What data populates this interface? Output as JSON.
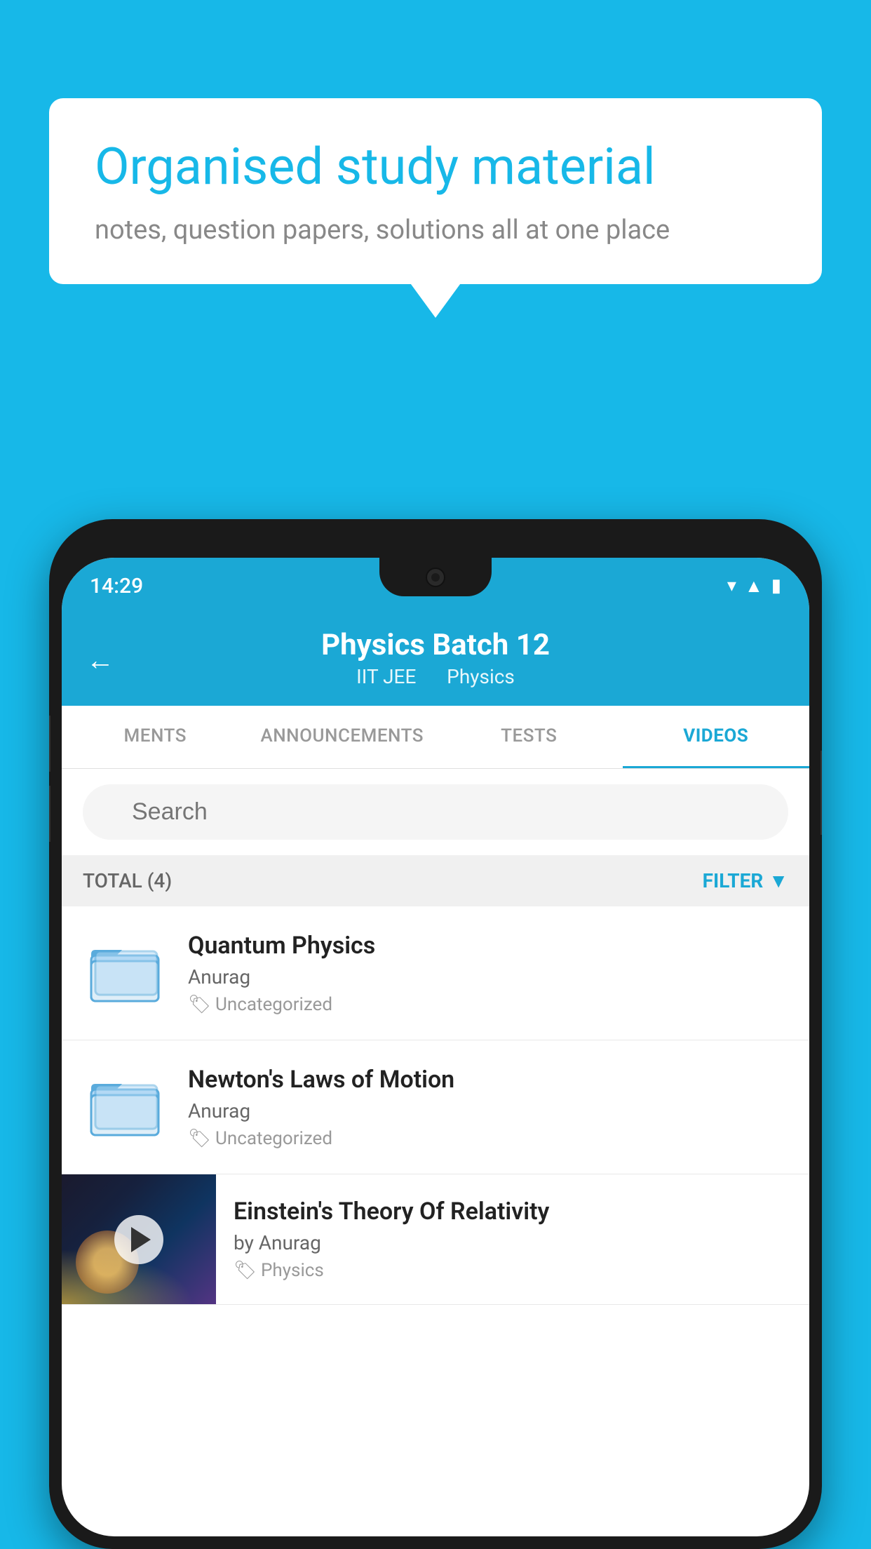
{
  "app": {
    "background_color": "#17b8e8"
  },
  "bubble": {
    "title": "Organised study material",
    "subtitle": "notes, question papers, solutions all at one place"
  },
  "status_bar": {
    "time": "14:29",
    "icons": [
      "wifi",
      "signal",
      "battery"
    ]
  },
  "header": {
    "title": "Physics Batch 12",
    "subtitle_part1": "IIT JEE",
    "subtitle_part2": "Physics",
    "back_label": "←"
  },
  "tabs": [
    {
      "label": "MENTS",
      "active": false
    },
    {
      "label": "ANNOUNCEMENTS",
      "active": false
    },
    {
      "label": "TESTS",
      "active": false
    },
    {
      "label": "VIDEOS",
      "active": true
    }
  ],
  "search": {
    "placeholder": "Search"
  },
  "filter_bar": {
    "total_label": "TOTAL (4)",
    "filter_label": "FILTER"
  },
  "videos": [
    {
      "id": 1,
      "title": "Quantum Physics",
      "author": "Anurag",
      "tag": "Uncategorized",
      "type": "folder",
      "has_thumbnail": false
    },
    {
      "id": 2,
      "title": "Newton's Laws of Motion",
      "author": "Anurag",
      "tag": "Uncategorized",
      "type": "folder",
      "has_thumbnail": false
    },
    {
      "id": 3,
      "title": "Einstein's Theory Of Relativity",
      "author": "by Anurag",
      "tag": "Physics",
      "type": "video",
      "has_thumbnail": true
    }
  ]
}
